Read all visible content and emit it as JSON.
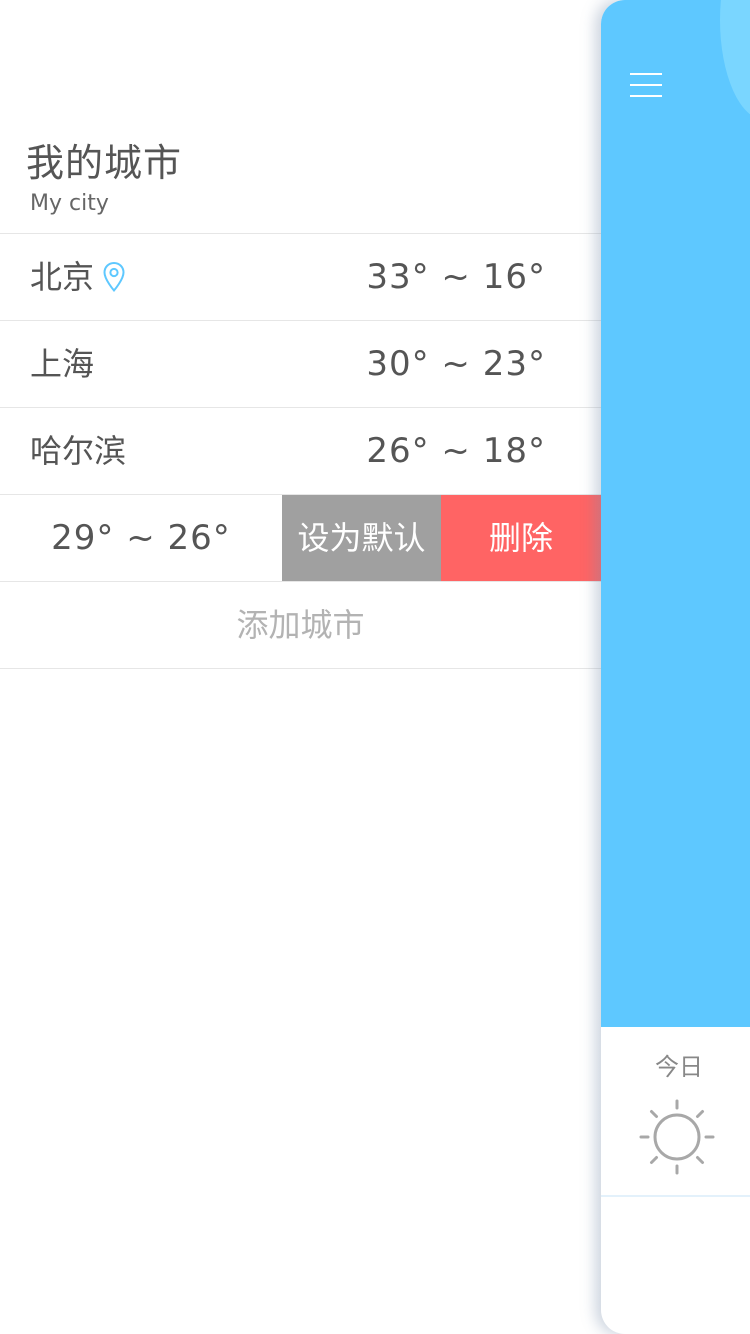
{
  "drawer": {
    "title": "我的城市",
    "subtitle": "My city",
    "cities": [
      {
        "name": "北京",
        "temp": "33° ~ 16°",
        "is_location": true
      },
      {
        "name": "上海",
        "temp": "30° ~ 23°"
      },
      {
        "name": "哈尔滨",
        "temp": "26° ~ 18°"
      }
    ],
    "swiped_row": {
      "temp": "29° ~ 26°",
      "set_default_label": "设为默认",
      "delete_label": "删除"
    },
    "add_city_label": "添加城市"
  },
  "main": {
    "today_label": "今日",
    "weather_icon": "sun-icon"
  },
  "colors": {
    "accent_blue": "#5ec8ff",
    "location_pin": "#5ec8ff",
    "delete_red": "#ff6464",
    "default_gray": "#a0a0a0"
  }
}
